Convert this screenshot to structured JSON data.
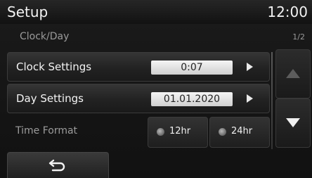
{
  "header": {
    "title": "Setup",
    "time": "12:00"
  },
  "subheader": {
    "title": "Clock/Day",
    "page": "1/2"
  },
  "rows": [
    {
      "label": "Clock Settings",
      "value": "0:07"
    },
    {
      "label": "Day Settings",
      "value": "01.01.2020"
    }
  ],
  "time_format": {
    "label": "Time Format",
    "options": [
      "12hr",
      "24hr"
    ]
  },
  "nav": {
    "up_icon": "triangle-up-icon",
    "down_icon": "triangle-down-icon"
  },
  "back": {
    "icon": "back-arrow-icon"
  }
}
